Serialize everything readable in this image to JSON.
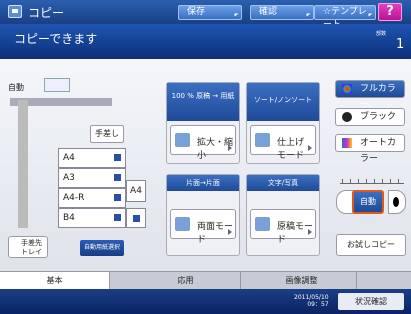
{
  "header": {
    "title": "コピー",
    "buttons": [
      {
        "label": "保存"
      },
      {
        "label": "確認"
      },
      {
        "label": "☆テンプレート"
      },
      {
        "label": "?"
      }
    ]
  },
  "status": {
    "message": "コピーできます",
    "count_label": "部数",
    "count": "1"
  },
  "machine": {
    "auto_label": "自動",
    "manual_feed": "手差し",
    "trays": [
      {
        "label": "A4"
      },
      {
        "label": "A3"
      },
      {
        "label": "A4-R"
      },
      {
        "label": "B4"
      }
    ],
    "side_tray": "A4",
    "bypass": "手差先 トレイ",
    "auto_paper": "自動用紙選択"
  },
  "groups": [
    {
      "caption": "100 % 原稿 → 用紙",
      "button": "拡大・縮小"
    },
    {
      "caption": "ソート/ノンソート",
      "button": "仕上げ モード"
    },
    {
      "caption": "片面→片面",
      "button": "両面モード"
    },
    {
      "caption": "文字/写真",
      "button": "原稿モード"
    }
  ],
  "color_modes": [
    {
      "label": "フルカラー"
    },
    {
      "label": "ブラック"
    },
    {
      "label": "オートカラー"
    }
  ],
  "density": {
    "auto": "自動"
  },
  "proof": "お試しコピー",
  "tabs": [
    {
      "label": "基本"
    },
    {
      "label": "応用"
    },
    {
      "label": "画像調整"
    }
  ],
  "footer": {
    "date": "2011/05/10",
    "time": "09：57",
    "status_button": "状況確認"
  }
}
